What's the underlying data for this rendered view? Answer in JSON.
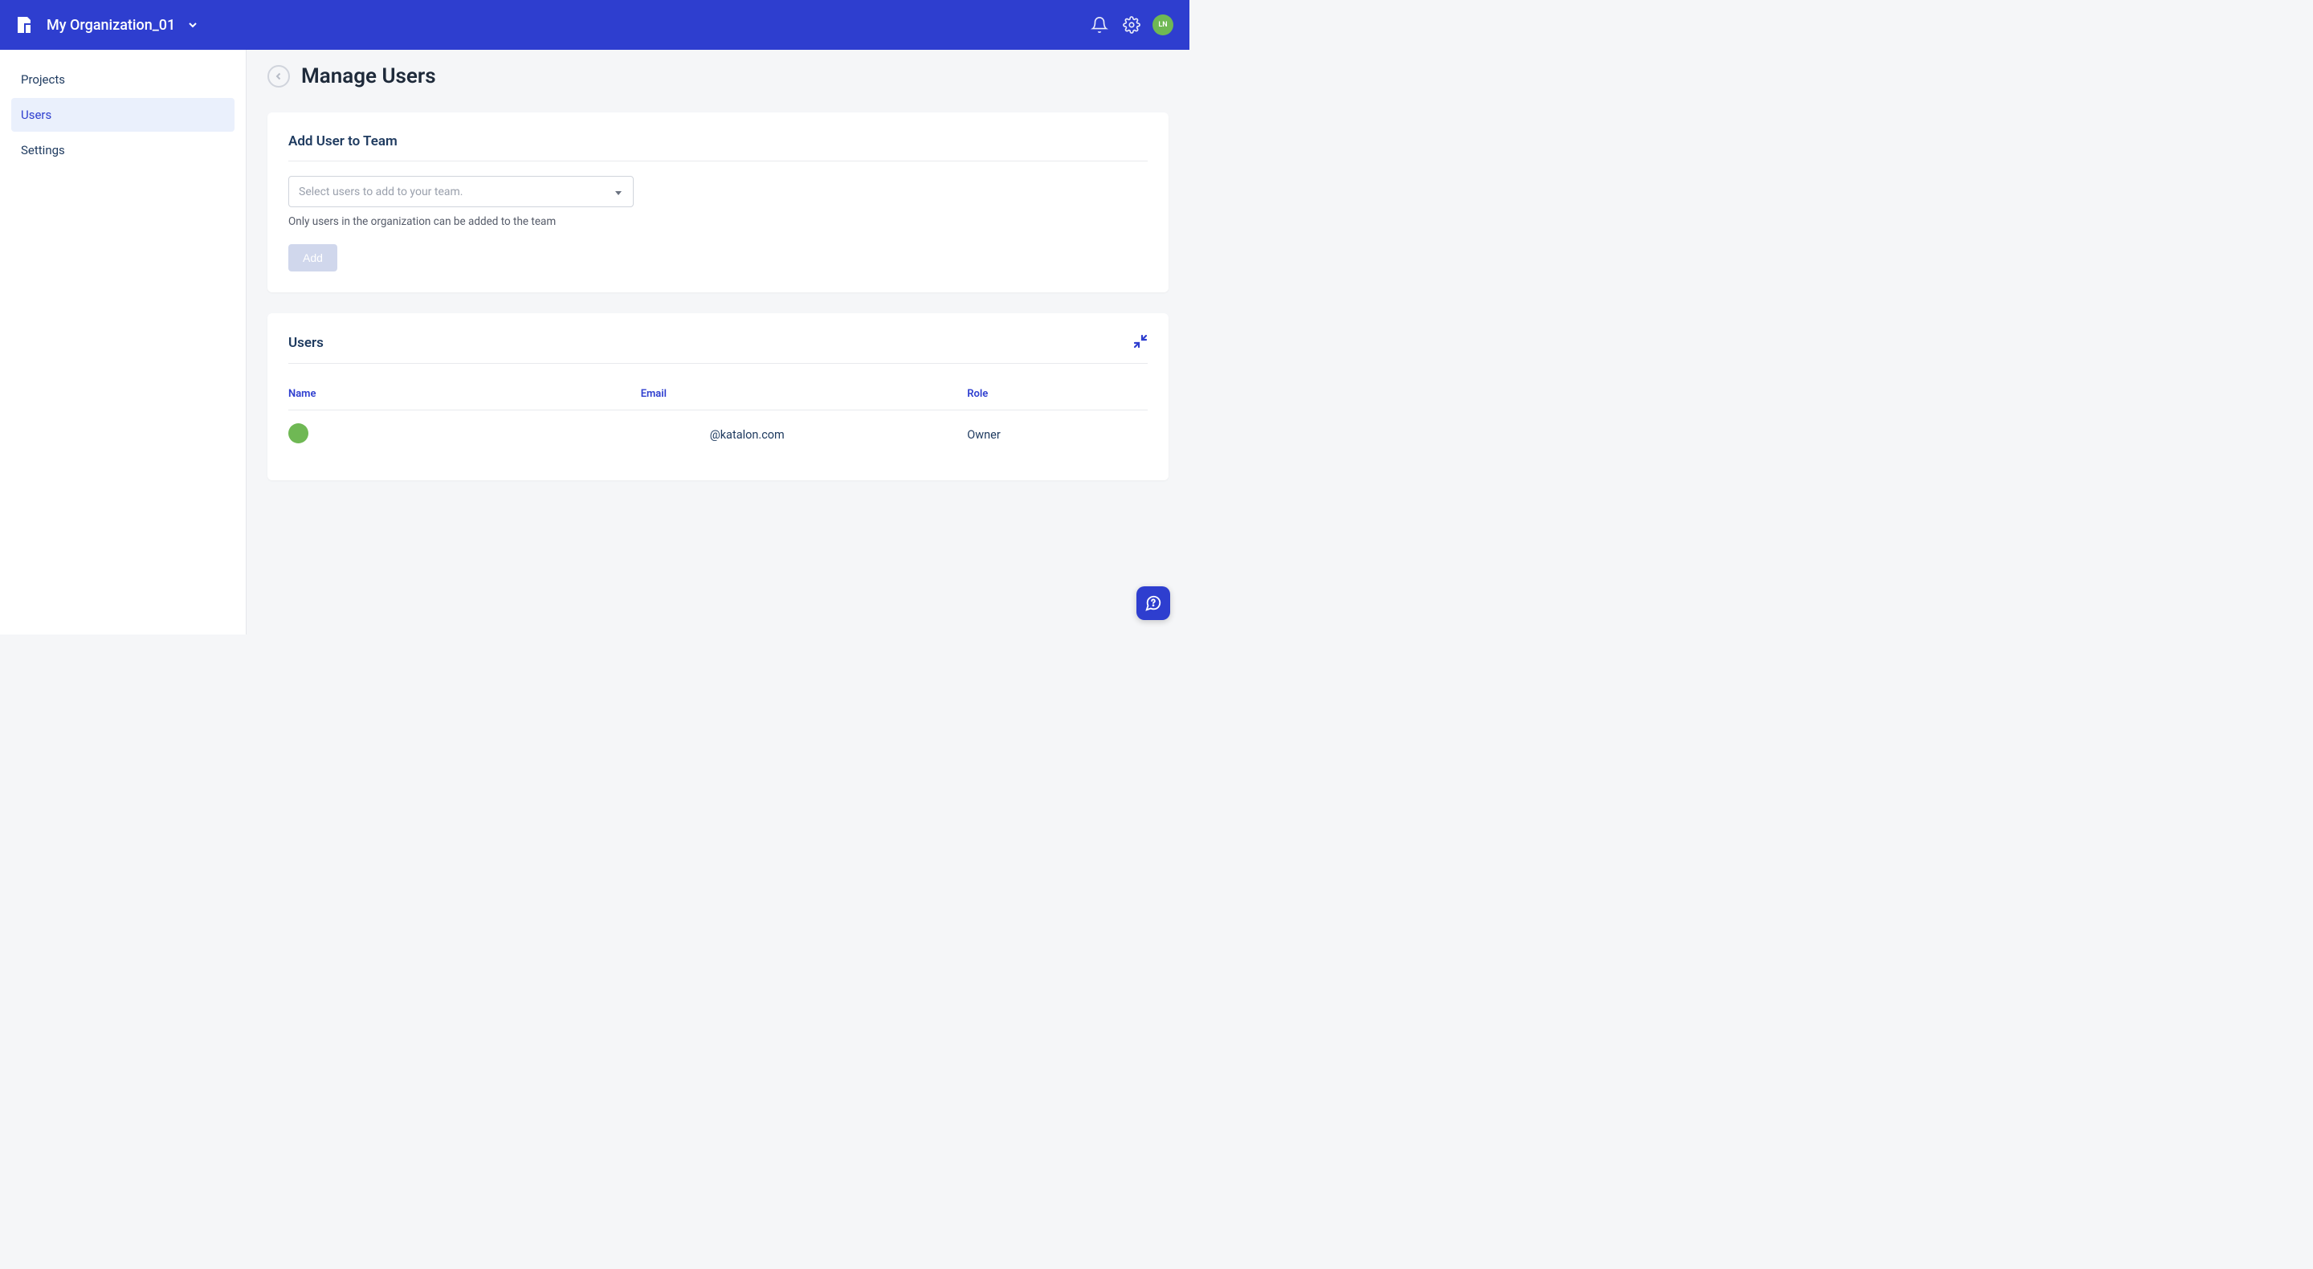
{
  "header": {
    "org_name": "My Organization_01",
    "avatar_initials": "LN"
  },
  "sidebar": {
    "items": [
      {
        "label": "Projects"
      },
      {
        "label": "Users"
      },
      {
        "label": "Settings"
      }
    ],
    "active_index": 1
  },
  "page": {
    "title": "Manage Users"
  },
  "add_user_card": {
    "title": "Add User to Team",
    "select_placeholder": "Select users to add to your team.",
    "helper_text": "Only users in the organization can be added to the team",
    "add_button_label": "Add"
  },
  "users_card": {
    "title": "Users",
    "columns": {
      "name": "Name",
      "email": "Email",
      "role": "Role"
    },
    "rows": [
      {
        "avatar_initials": "",
        "name": "",
        "email": "@katalon.com",
        "role": "Owner"
      }
    ]
  }
}
